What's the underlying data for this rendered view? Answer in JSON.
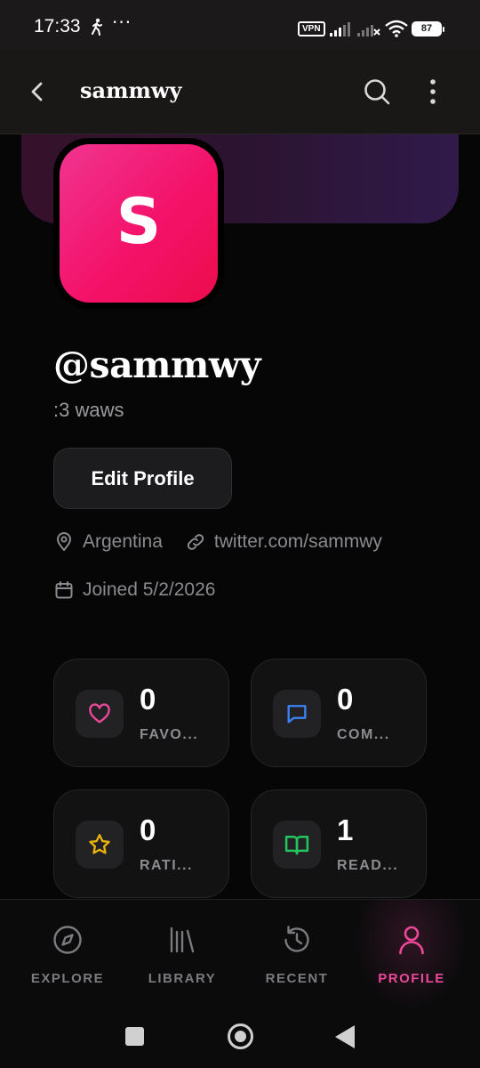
{
  "status_bar": {
    "time": "17:33",
    "dots": "···",
    "vpn": "VPN",
    "battery": "87",
    "icons": [
      "walking-icon",
      "signal-icon",
      "signal-no-service-icon",
      "wifi-icon",
      "battery-icon"
    ]
  },
  "header": {
    "title": "sammwy",
    "icons": [
      "back-arrow-icon",
      "search-icon",
      "more-vertical-icon"
    ]
  },
  "profile": {
    "avatar_letter": "S",
    "handle": "@sammwy",
    "bio": ":3 waws",
    "edit_button": "Edit Profile",
    "location": "Argentina",
    "link": "twitter.com/sammwy",
    "joined": "Joined 5/2/2026"
  },
  "stats": [
    {
      "value": "0",
      "label": "FAVO...",
      "icon": "heart-icon",
      "color": "#ec4899"
    },
    {
      "value": "0",
      "label": "COM...",
      "icon": "chat-bubble-icon",
      "color": "#3b82f6"
    },
    {
      "value": "0",
      "label": "RATI...",
      "icon": "star-icon",
      "color": "#eab308"
    },
    {
      "value": "1",
      "label": "READ...",
      "icon": "open-book-icon",
      "color": "#22c55e"
    }
  ],
  "bottom_nav": [
    {
      "label": "EXPLORE",
      "icon": "compass-icon",
      "active": false
    },
    {
      "label": "LIBRARY",
      "icon": "library-icon",
      "active": false
    },
    {
      "label": "RECENT",
      "icon": "history-icon",
      "active": false
    },
    {
      "label": "PROFILE",
      "icon": "user-icon",
      "active": true
    }
  ],
  "colors": {
    "accent": "#ec4899",
    "background": "#060606",
    "card": "#121213"
  }
}
